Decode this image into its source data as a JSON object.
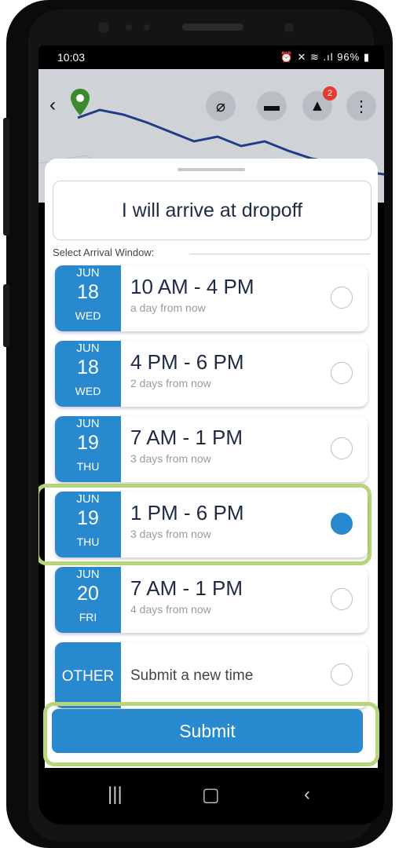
{
  "status": {
    "time": "10:03",
    "right": "⏰ ✕ ≋ .ıl 96% ▮"
  },
  "map": {
    "notifications": "2"
  },
  "sheet": {
    "title": "I will arrive at dropoff",
    "section_label": "Select Arrival Window:"
  },
  "slots": [
    {
      "month": "JUN",
      "day": "18",
      "dow": "WED",
      "time": "10 AM - 4 PM",
      "relative": "a day from now",
      "selected": false
    },
    {
      "month": "JUN",
      "day": "18",
      "dow": "WED",
      "time": "4 PM - 6 PM",
      "relative": "2 days from now",
      "selected": false
    },
    {
      "month": "JUN",
      "day": "19",
      "dow": "THU",
      "time": "7 AM - 1 PM",
      "relative": "3 days from now",
      "selected": false
    },
    {
      "month": "JUN",
      "day": "19",
      "dow": "THU",
      "time": "1 PM - 6 PM",
      "relative": "3 days from now",
      "selected": true
    },
    {
      "month": "JUN",
      "day": "20",
      "dow": "FRI",
      "time": "7 AM - 1 PM",
      "relative": "4 days from now",
      "selected": false
    }
  ],
  "other": {
    "label": "OTHER",
    "text": "Submit a new time",
    "selected": false
  },
  "submit_label": "Submit",
  "colors": {
    "accent": "#2889cf",
    "highlight": "#b5d67a",
    "title_text": "#1e2b45"
  }
}
